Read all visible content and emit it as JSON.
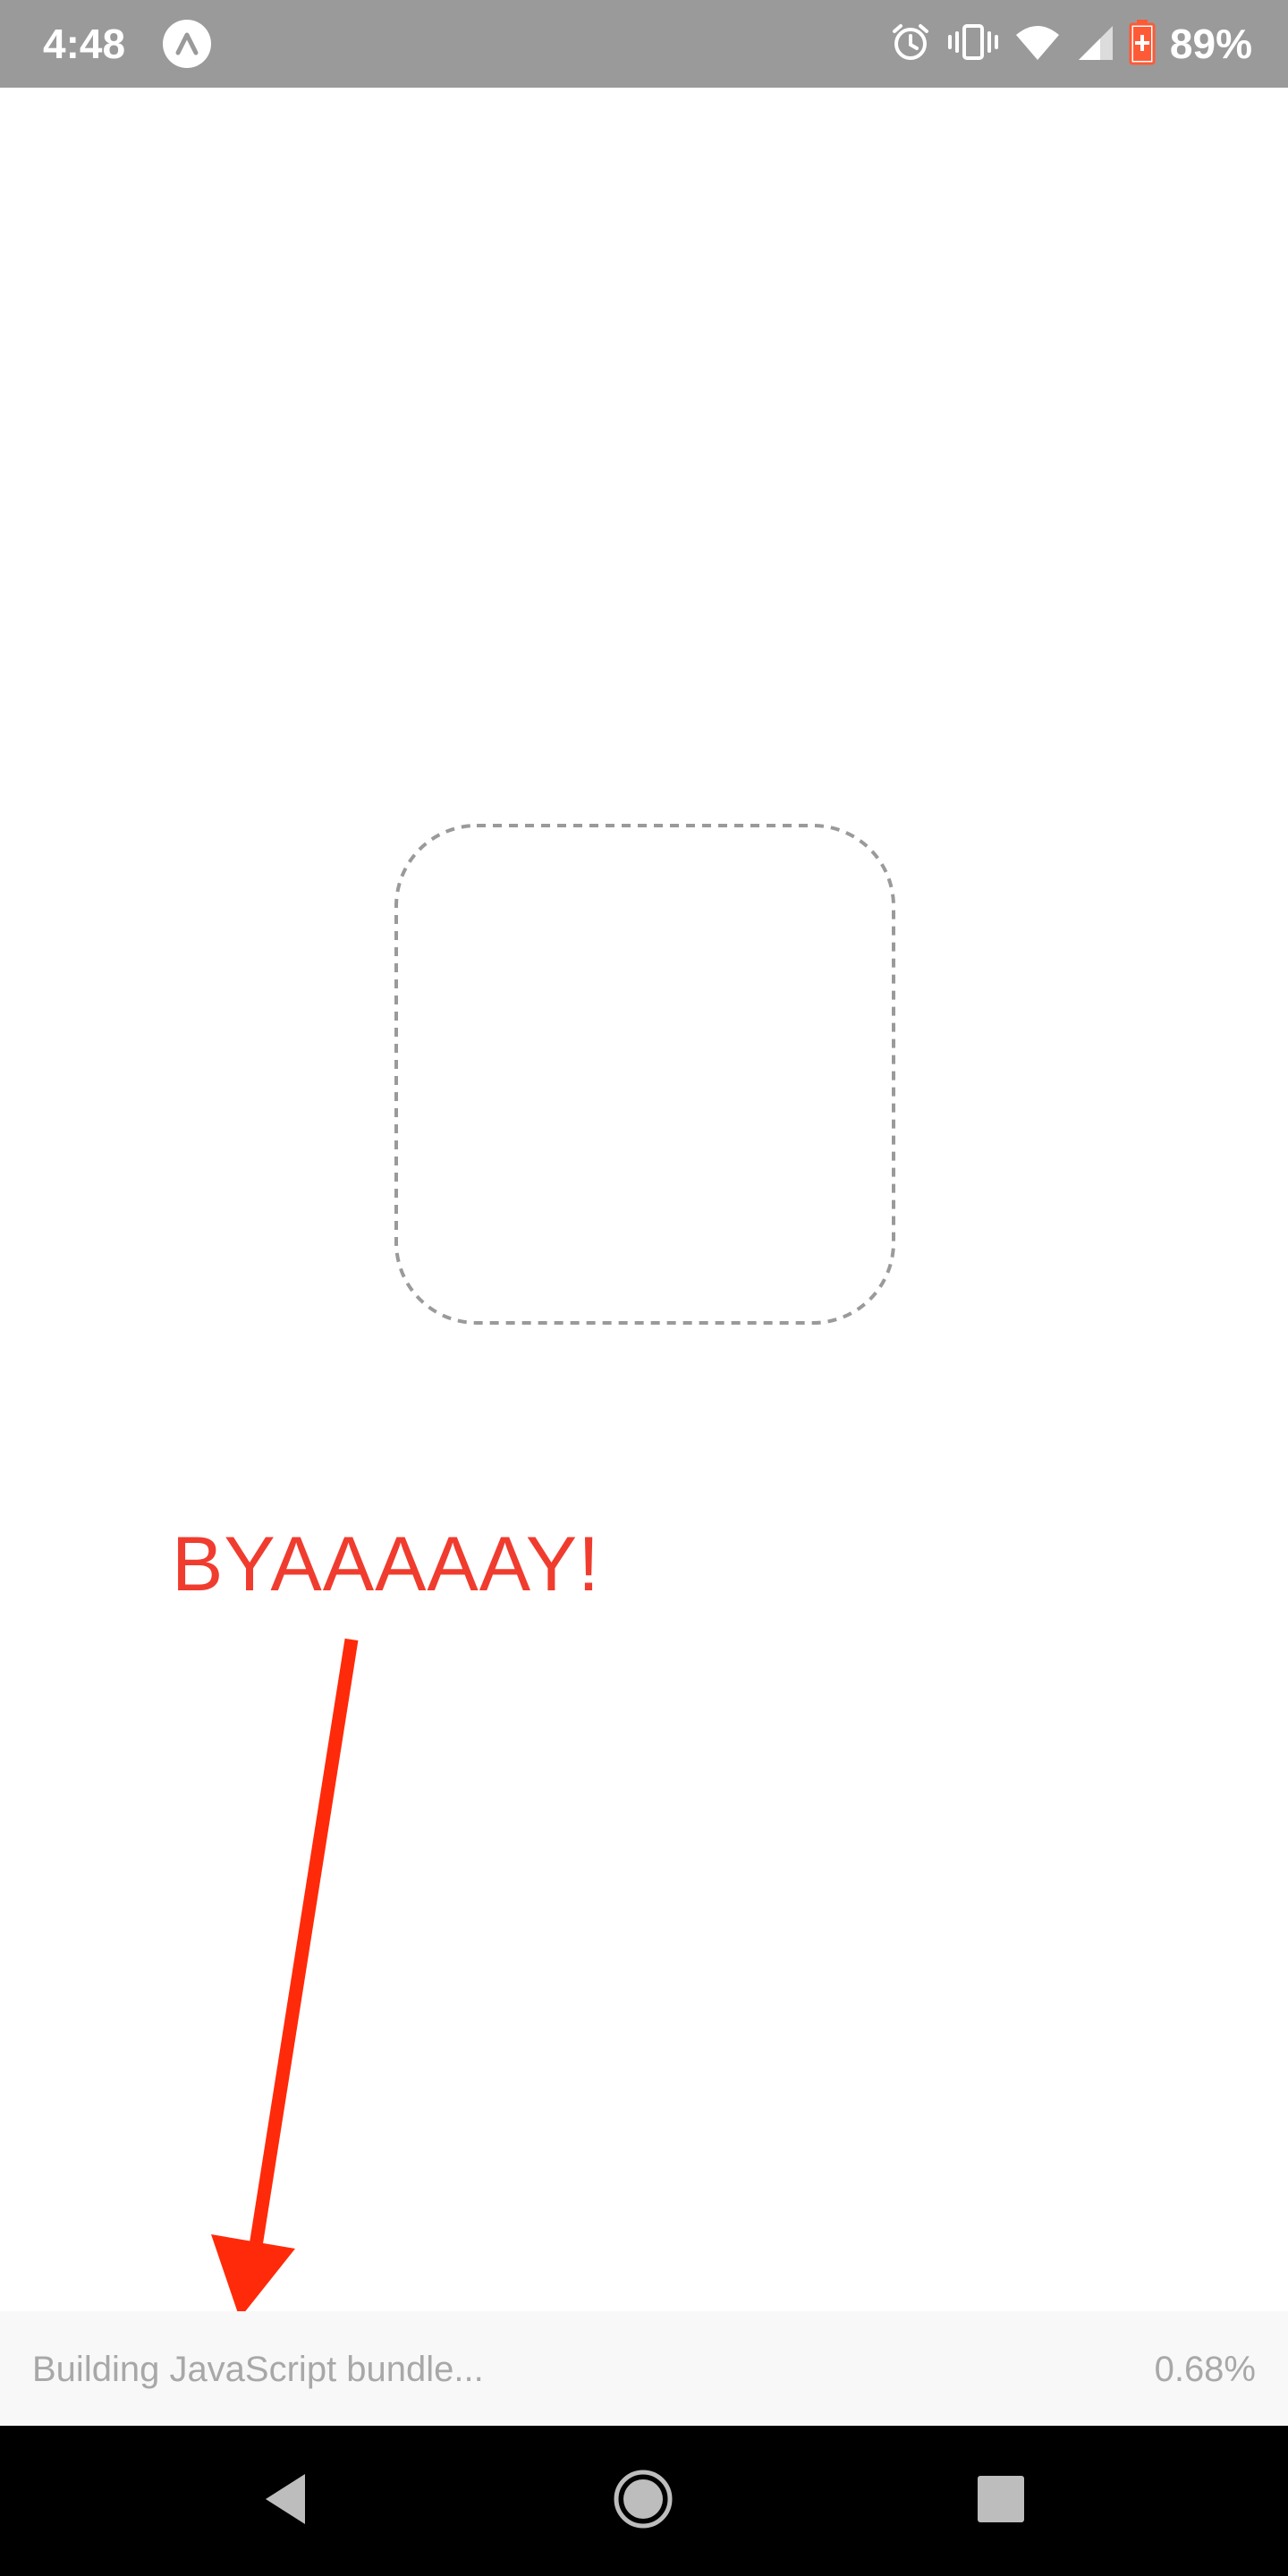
{
  "status_bar": {
    "time": "4:48",
    "battery_percent": "89%",
    "icons": [
      "expo-icon",
      "alarm-icon",
      "vibrate-icon",
      "wifi-icon",
      "cell-signal-icon",
      "battery-charging-icon"
    ],
    "battery_accent": "#ff5a36"
  },
  "annotation": {
    "text": "BYAAAAAY!",
    "color": "#f03c2e"
  },
  "bundle_bar": {
    "status_text": "Building JavaScript bundle...",
    "progress": "0.68%"
  },
  "nav_bar": {
    "icons": [
      "back-icon",
      "home-icon",
      "recents-icon"
    ]
  }
}
